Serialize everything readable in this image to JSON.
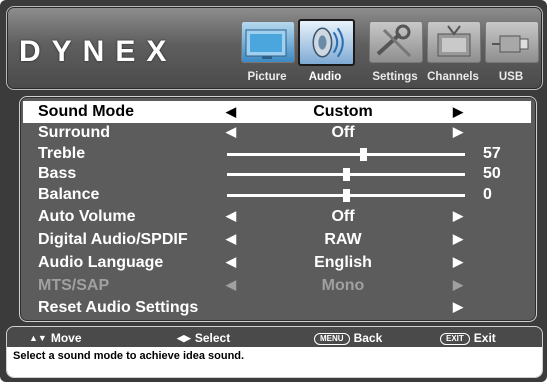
{
  "brand": {
    "logo_text": "DYNEX"
  },
  "tabs": [
    {
      "label": "Picture",
      "icon": "picture-icon",
      "active": false
    },
    {
      "label": "Audio",
      "icon": "audio-icon",
      "active": true
    },
    {
      "label": "Settings",
      "icon": "settings-icon",
      "active": false
    },
    {
      "label": "Channels",
      "icon": "channels-icon",
      "active": false
    },
    {
      "label": "USB",
      "icon": "usb-icon",
      "active": false
    }
  ],
  "menu": {
    "sound_mode": {
      "label": "Sound Mode",
      "value": "Custom"
    },
    "surround": {
      "label": "Surround",
      "value": "Off"
    },
    "treble": {
      "label": "Treble",
      "value": "57",
      "level": 57
    },
    "bass": {
      "label": "Bass",
      "value": "50",
      "level": 50
    },
    "balance": {
      "label": "Balance",
      "value": "0",
      "level": 0
    },
    "auto_volume": {
      "label": "Auto Volume",
      "value": "Off"
    },
    "digital_audio": {
      "label": "Digital Audio/SPDIF",
      "value": "RAW"
    },
    "audio_language": {
      "label": "Audio Language",
      "value": "English"
    },
    "mts_sap": {
      "label": "MTS/SAP",
      "value": "Mono"
    },
    "reset": {
      "label": "Reset Audio Settings"
    }
  },
  "hints": {
    "move": "Move",
    "select": "Select",
    "menu_key": "MENU",
    "back": "Back",
    "exit_key": "EXIT",
    "exit": "Exit"
  },
  "help_text": "Select a sound mode to achieve idea sound.",
  "colors": {
    "background": "#3b3b3b",
    "selected_row": "#ffffff",
    "disabled_text": "#a0a0a0"
  }
}
